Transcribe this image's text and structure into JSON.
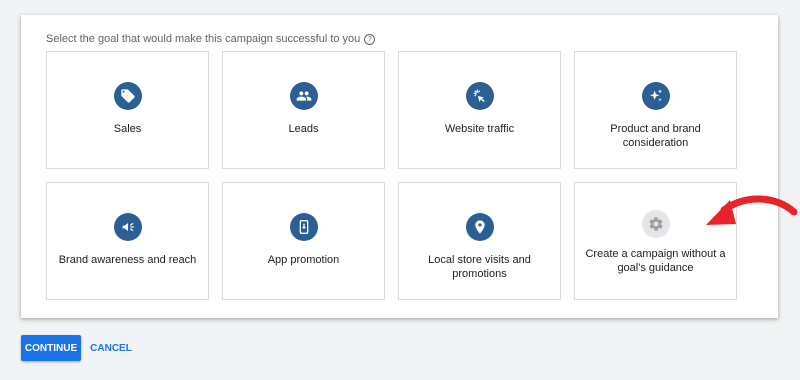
{
  "prompt": {
    "text": "Select the goal that would make this campaign successful to you",
    "help_icon": "help-circle-icon"
  },
  "goals": [
    {
      "label": "Sales",
      "icon": "tag-icon"
    },
    {
      "label": "Leads",
      "icon": "people-icon"
    },
    {
      "label": "Website traffic",
      "icon": "cursor-click-icon"
    },
    {
      "label": "Product and brand consideration",
      "icon": "sparkle-icon"
    },
    {
      "label": "Brand awareness and reach",
      "icon": "speaker-icon"
    },
    {
      "label": "App promotion",
      "icon": "phone-download-icon"
    },
    {
      "label": "Local store visits and promotions",
      "icon": "map-pin-icon"
    },
    {
      "label": "Create a campaign without a goal's guidance",
      "icon": "gear-icon"
    }
  ],
  "buttons": {
    "continue": "CONTINUE",
    "cancel": "CANCEL"
  },
  "colors": {
    "icon_bg": "#2c5f94",
    "icon_bg_muted": "#e3e5e7",
    "primary": "#1a73e8",
    "annotation_arrow": "#e8242a"
  }
}
